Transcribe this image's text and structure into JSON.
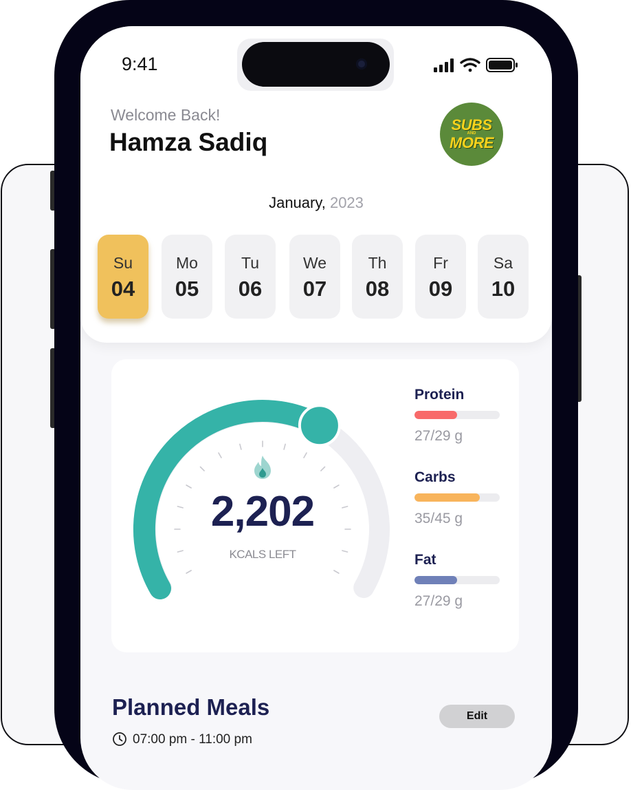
{
  "status": {
    "time": "9:41"
  },
  "header": {
    "greeting": "Welcome Back!",
    "user_name": "Hamza Sadiq",
    "logo": {
      "line1": "SUBS",
      "line2": "AND",
      "line3": "MORE",
      "bg_color": "#5b8a3a",
      "text_color": "#f7d21c"
    }
  },
  "calendar": {
    "month": "January,",
    "year": "2023",
    "days": [
      {
        "name": "Su",
        "num": "04",
        "active": true
      },
      {
        "name": "Mo",
        "num": "05",
        "active": false
      },
      {
        "name": "Tu",
        "num": "06",
        "active": false
      },
      {
        "name": "We",
        "num": "07",
        "active": false
      },
      {
        "name": "Th",
        "num": "08",
        "active": false
      },
      {
        "name": "Fr",
        "num": "09",
        "active": false
      },
      {
        "name": "Sa",
        "num": "10",
        "active": false
      }
    ],
    "active_color": "#f0c15c"
  },
  "calories": {
    "value": "2,202",
    "label": "KCALS LEFT",
    "progress": 0.62,
    "accent_color": "#35b3a8",
    "icon": "flame-icon"
  },
  "macros": [
    {
      "name": "Protein",
      "value": "27/29 g",
      "fraction": 0.5,
      "color": "#f86a6a"
    },
    {
      "name": "Carbs",
      "value": "35/45 g",
      "fraction": 0.77,
      "color": "#f8b45c"
    },
    {
      "name": "Fat",
      "value": "27/29 g",
      "fraction": 0.5,
      "color": "#6f80b8"
    }
  ],
  "meals": {
    "title": "Planned Meals",
    "edit_label": "Edit",
    "time_range": "07:00 pm - 11:00 pm",
    "icon": "clock-icon"
  }
}
